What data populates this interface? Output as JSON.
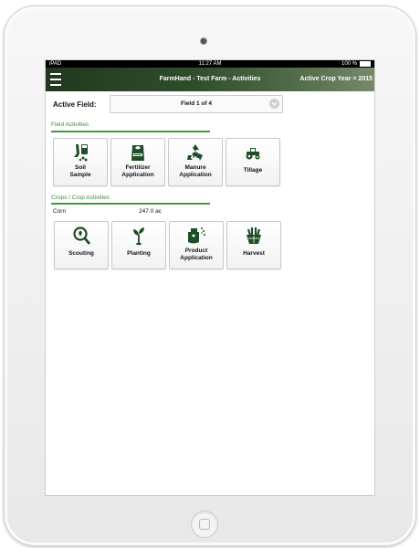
{
  "status_bar": {
    "carrier": "iPAD",
    "time": "11:27 AM",
    "battery": "100 %"
  },
  "nav": {
    "title": "FarmHand - Test Farm - Activities",
    "crop_year": "Active Crop Year = 2015"
  },
  "active_field": {
    "label": "Active Field:",
    "value": "Field 1 of 4"
  },
  "field_activities": {
    "title": "Field Activities",
    "items": [
      {
        "label_line1": "Soil",
        "label_line2": "Sample",
        "icon": "soil-sample-icon"
      },
      {
        "label_line1": "Fertilizer",
        "label_line2": "Application",
        "icon": "fertilizer-bag-icon"
      },
      {
        "label_line1": "Manure",
        "label_line2": "Application",
        "icon": "recycle-cow-icon"
      },
      {
        "label_line1": "Tillage",
        "label_line2": "",
        "icon": "tractor-icon"
      }
    ]
  },
  "crop_activities": {
    "title": "Crops / Crop Activities",
    "crop": {
      "name": "Corn",
      "area": "247.0 ac"
    },
    "items": [
      {
        "label_line1": "Scouting",
        "label_line2": "",
        "icon": "magnifier-leaf-icon"
      },
      {
        "label_line1": "Planting",
        "label_line2": "",
        "icon": "seedling-icon"
      },
      {
        "label_line1": "Product",
        "label_line2": "Application",
        "icon": "sprayer-icon"
      },
      {
        "label_line1": "Harvest",
        "label_line2": "",
        "icon": "harvest-basket-icon"
      }
    ]
  },
  "colors": {
    "accent_green": "#3f9a3f",
    "nav_dark": "#21381f",
    "icon_green": "#1f4d26"
  }
}
